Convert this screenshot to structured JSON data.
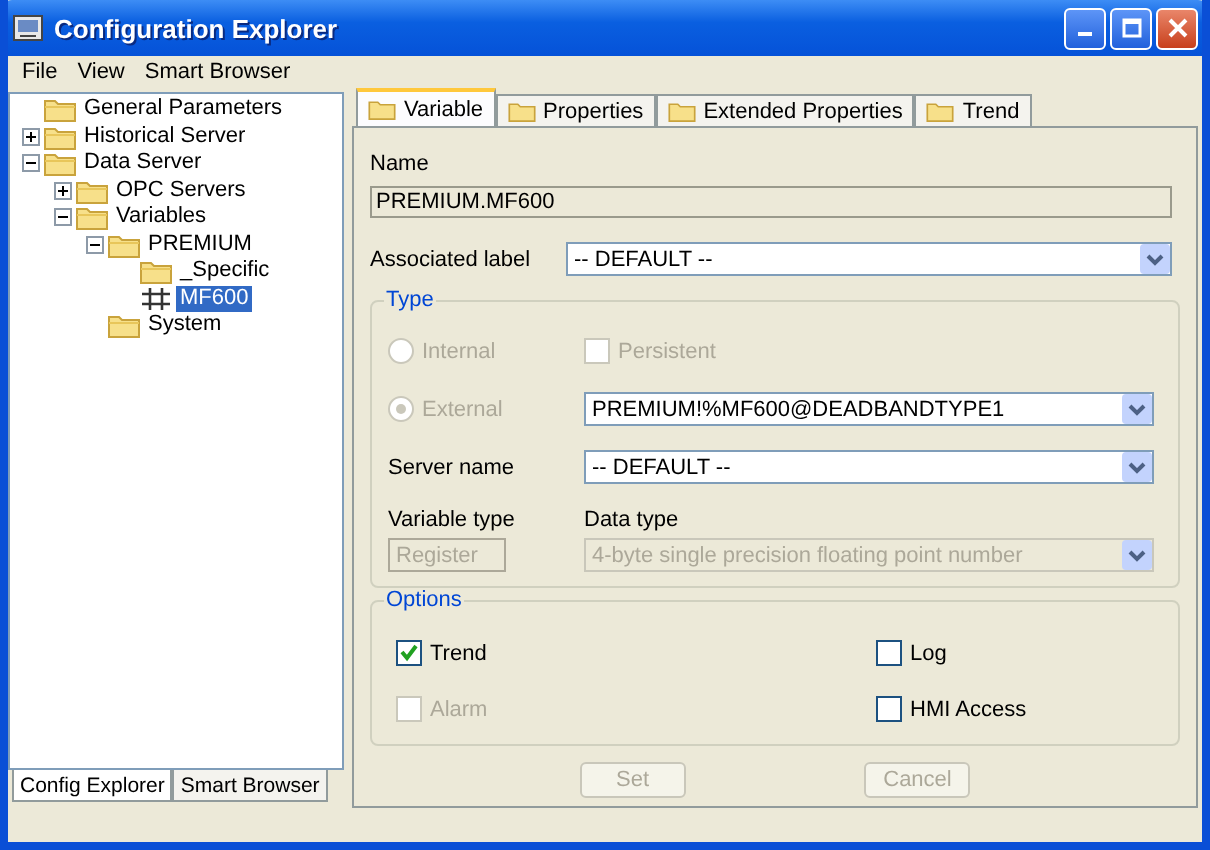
{
  "window": {
    "title": "Configuration Explorer"
  },
  "menu": [
    "File",
    "View",
    "Smart Browser"
  ],
  "tree": [
    {
      "label": "General Parameters",
      "kind": "folder",
      "selected": false
    },
    {
      "label": "Historical Server",
      "kind": "folder",
      "selected": false,
      "expanded": false
    },
    {
      "label": "Data Server",
      "kind": "folder",
      "selected": false,
      "expanded": true,
      "children": [
        {
          "label": "OPC Servers",
          "kind": "folder",
          "selected": false,
          "expanded": false
        },
        {
          "label": "Variables",
          "kind": "folder",
          "selected": false,
          "expanded": true,
          "children": [
            {
              "label": "PREMIUM",
              "kind": "folder",
              "selected": false,
              "expanded": true,
              "children": [
                {
                  "label": "_Specific",
                  "kind": "folder",
                  "selected": false
                },
                {
                  "label": "MF600",
                  "kind": "variable",
                  "selected": true
                }
              ]
            },
            {
              "label": "System",
              "kind": "folder",
              "selected": false
            }
          ]
        }
      ]
    }
  ],
  "left_tabs": [
    {
      "label": "Config Explorer",
      "selected": true
    },
    {
      "label": "Smart Browser",
      "selected": false
    }
  ],
  "tabs": [
    {
      "label": "Variable",
      "selected": true
    },
    {
      "label": "Properties",
      "selected": false
    },
    {
      "label": "Extended Properties",
      "selected": false
    },
    {
      "label": "Trend",
      "selected": false
    }
  ],
  "form": {
    "name_label": "Name",
    "name_value": "PREMIUM.MF600",
    "associated": {
      "label": "Associated label",
      "value": "-- DEFAULT --"
    },
    "type_group": {
      "title": "Type",
      "internal": {
        "label": "Internal",
        "selected": false,
        "disabled": true
      },
      "persistent": {
        "label": "Persistent",
        "checked": false,
        "disabled": true
      },
      "external": {
        "label": "External",
        "selected": true,
        "disabled": true,
        "value": "PREMIUM!%MF600@DEADBANDTYPE1"
      },
      "server_name": {
        "label": "Server name",
        "value": "-- DEFAULT --"
      },
      "variable_type": {
        "label": "Variable type",
        "value": "Register"
      },
      "data_type": {
        "label": "Data type",
        "value": "4-byte single precision floating point number",
        "disabled": true
      }
    },
    "options": {
      "title": "Options",
      "items": [
        {
          "label": "Trend",
          "checked": true,
          "disabled": false
        },
        {
          "label": "Log",
          "checked": false,
          "disabled": false
        },
        {
          "label": "Alarm",
          "checked": false,
          "disabled": true
        },
        {
          "label": "HMI Access",
          "checked": false,
          "disabled": false
        }
      ]
    },
    "buttons": [
      {
        "label": "Set",
        "disabled": true
      },
      {
        "label": "Cancel",
        "disabled": true
      }
    ]
  }
}
